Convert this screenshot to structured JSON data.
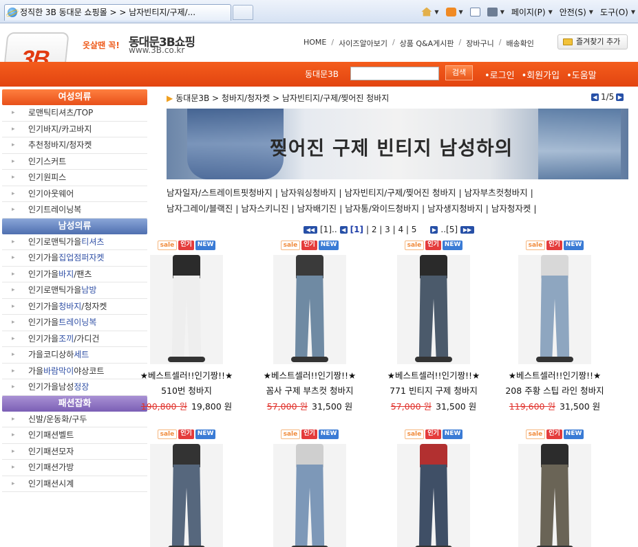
{
  "browser": {
    "tab_title": "정직한 3B 동대문 쇼핑몰 > > 남자빈티지/구제/...",
    "cmd_page": "페이지(P)",
    "cmd_safety": "안전(S)",
    "cmd_tools": "도구(O)"
  },
  "header": {
    "logo_text": "3B",
    "slogan": "옷살땐 꼭!",
    "site_title": "동대문3B쇼핑",
    "site_url": "www.3B.co.kr",
    "nav": [
      "HOME",
      "사이즈알아보기",
      "상품 Q&A게시판",
      "장바구니",
      "배송확인"
    ],
    "fav_label": "즐겨찾기 추가"
  },
  "searchbar": {
    "label": "동대문3B",
    "input_value": "",
    "button_label": "검색",
    "links": [
      "•로그인",
      "•회원가입",
      "•도움말"
    ]
  },
  "sidebar": {
    "women_title": "여성의류",
    "women_items": [
      "로맨틱티셔츠/TOP",
      "인기바지/카고바지",
      "추천청바지/청자켓",
      "인기스커트",
      "인기원피스",
      "인기아웃웨어",
      "인기트레이닝복"
    ],
    "men_title": "남성의류",
    "men_items": [
      {
        "pre": "인기로맨틱가을",
        "hl": "티셔츠",
        "post": ""
      },
      {
        "pre": "인기가을",
        "hl": "집업점퍼자켓",
        "post": ""
      },
      {
        "pre": "인기가을",
        "hl": "바지",
        "post": "/팬츠"
      },
      {
        "pre": "인기로맨틱가을",
        "hl": "남방",
        "post": ""
      },
      {
        "pre": "인기가을",
        "hl": "청바지",
        "post": "/청자켓"
      },
      {
        "pre": "인기가을",
        "hl": "트레이닝복",
        "post": ""
      },
      {
        "pre": "인기가을",
        "hl": "조끼",
        "post": "/가디건"
      },
      {
        "pre": "가을코디상하",
        "hl": "세트",
        "post": ""
      },
      {
        "pre": "가을",
        "hl": "바람막이",
        "post": "야상코트"
      },
      {
        "pre": "인기가을남성",
        "hl": "정장",
        "post": ""
      }
    ],
    "acc_title": "패션잡화",
    "acc_items": [
      "신발/운동화/구두",
      "인기패션벨트",
      "인기패션모자",
      "인기패션가방",
      "인기패션시계"
    ]
  },
  "main": {
    "breadcrumb": "동대문3B > 청바지/청자켓 > 남자빈티지/구제/찢어진 청바지",
    "page_indicator": "1/5",
    "banner_text": "찢어진 구제 빈티지 남성하의",
    "subcats_line1": [
      "남자일자/스트레이트핏청바지",
      "남자워싱청바지",
      "남자빈티지/구제/찢어진 청바지",
      "남자부츠컷청바지"
    ],
    "subcats_line2": [
      "남자그레이/블랙진",
      "남자스키니진",
      "남자배기진",
      "남자통/와이드청바지",
      "남자생지청바지",
      "남자청자켓"
    ],
    "pager": {
      "first": "[1]..",
      "current": "[1]",
      "pages": "| 2 | 3 | 4 | 5",
      "last": "..[5]"
    },
    "badges": {
      "sale": "sale",
      "popular": "인기",
      "new": "NEW"
    },
    "products": [
      {
        "tag": "★베스트셀러!!인기짱!!★",
        "name": "510번 청바지",
        "old_price": "190,800 원",
        "price": "19,800 원",
        "pants_color": "#eeeeee",
        "top_color": "#2b2b2b"
      },
      {
        "tag": "★베스트셀러!!인기짱!!★",
        "name": "꼼사 구제 부츠컷 청바지",
        "old_price": "57,000 원",
        "price": "31,500 원",
        "pants_color": "#6f8aa3",
        "top_color": "#3a3a3a"
      },
      {
        "tag": "★베스트셀러!!인기짱!!★",
        "name": "771 빈티지 구제 청바지",
        "old_price": "57,000 원",
        "price": "31,500 원",
        "pants_color": "#4b5a6b",
        "top_color": "#2a2a2a"
      },
      {
        "tag": "★베스트셀러!!인기짱!!★",
        "name": "208 주황 스팁 라인 청바지",
        "old_price": "119,600 원",
        "price": "31,500 원",
        "pants_color": "#8ea6c0",
        "top_color": "#d8d8d8"
      },
      {
        "pants_color": "#56677d",
        "top_color": "#333333"
      },
      {
        "pants_color": "#7d98b8",
        "top_color": "#cfcfcf"
      },
      {
        "pants_color": "#3f4f66",
        "top_color": "#b23030"
      },
      {
        "pants_color": "#6a6456",
        "top_color": "#2c2c2c"
      }
    ]
  }
}
